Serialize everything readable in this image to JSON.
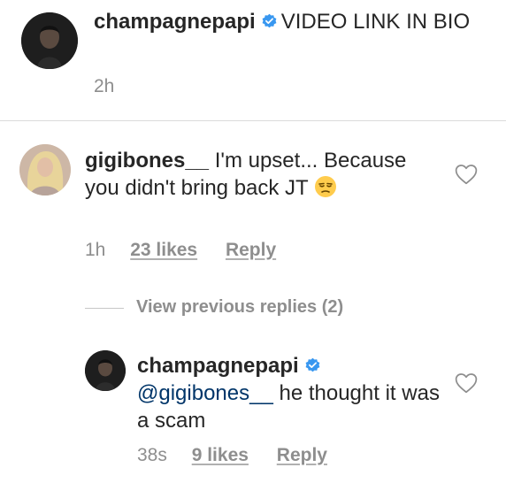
{
  "post": {
    "username": "champagnepapi",
    "caption": "VIDEO LINK IN BIO",
    "time": "2h"
  },
  "comments": [
    {
      "username": "gigibones__",
      "text": "I'm upset... Because you didn't bring back JT",
      "emoji": "unamused-face",
      "time": "1h",
      "likes": "23 likes",
      "reply": "Reply"
    }
  ],
  "view_previous": "View previous replies (2)",
  "reply": {
    "username": "champagnepapi",
    "mention": "@gigibones__",
    "text": "he thought it was a scam",
    "time": "38s",
    "likes": "9 likes",
    "reply": "Reply"
  },
  "icons": {
    "verified": "verified-badge-icon",
    "heart": "heart-outline-icon"
  },
  "colors": {
    "verified_blue": "#3897f0",
    "text": "#262626",
    "meta": "#8e8e8e",
    "mention": "#003569"
  }
}
